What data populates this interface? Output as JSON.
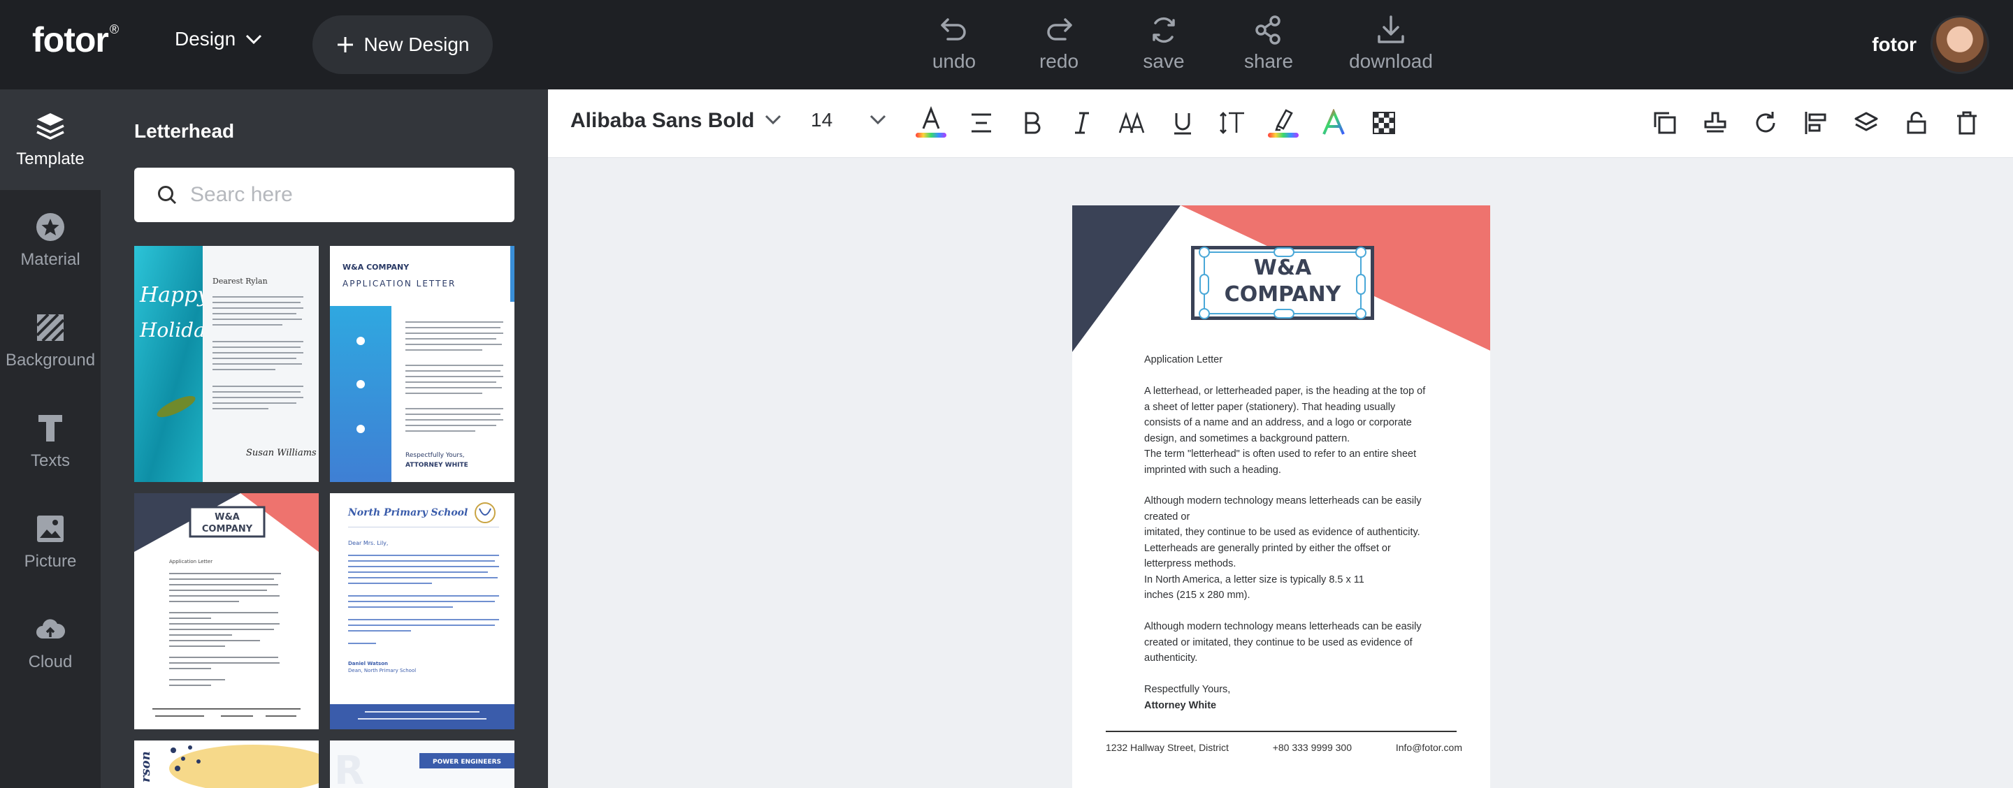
{
  "header": {
    "logo": "fotor",
    "logo_mark": "®",
    "design_menu": "Design",
    "new_design": "New Design",
    "tools": [
      {
        "label": "undo",
        "icon": "undo-icon"
      },
      {
        "label": "redo",
        "icon": "redo-icon"
      },
      {
        "label": "save",
        "icon": "save-icon"
      },
      {
        "label": "share",
        "icon": "share-icon"
      },
      {
        "label": "download",
        "icon": "download-icon"
      }
    ],
    "user_name": "fotor"
  },
  "leftnav": {
    "items": [
      {
        "label": "Template",
        "icon": "layers-icon",
        "active": true
      },
      {
        "label": "Material",
        "icon": "star-icon"
      },
      {
        "label": "Background",
        "icon": "background-icon"
      },
      {
        "label": "Texts",
        "icon": "text-icon"
      },
      {
        "label": "Picture",
        "icon": "picture-icon"
      },
      {
        "label": "Cloud",
        "icon": "cloud-icon"
      }
    ]
  },
  "panel": {
    "title": "Letterhead",
    "search_placeholder": "Searc here",
    "templates": [
      {
        "title": "Happy Holiday",
        "recipient": "Dearest Rylan",
        "signature": "Susan Williams"
      },
      {
        "title": "W&A COMPANY",
        "subtitle": "APPLICATION LETTER",
        "closing": "Respectfully Yours,",
        "signer": "ATTORNEY WHITE"
      },
      {
        "title": "W&A COMPANY",
        "subtitle": "Application Letter"
      },
      {
        "title": "North Primary School",
        "greeting": "Dear Mrs. Lily,",
        "signer": "Daniel Watson",
        "role": "Dean, North Primary School"
      },
      {
        "title": "rson"
      },
      {
        "title": "POWER ENGINEERS"
      }
    ]
  },
  "format_bar": {
    "font_name": "Alibaba Sans Bold",
    "font_size": "14",
    "colors": {
      "text_underline": "rainbow",
      "accent": "#4aa8d8"
    }
  },
  "letter": {
    "company_line1": "W&A",
    "company_line2": "COMPANY",
    "heading": "Application Letter",
    "paragraphs": [
      [
        "A letterhead, or letterheaded paper, is the heading at the top of",
        "a sheet of letter paper (stationery). That heading usually",
        "consists of a name and an address, and a logo or corporate",
        "design, and sometimes a background pattern.",
        "The term \"letterhead\" is often used to refer to an entire sheet",
        "imprinted with such a heading."
      ],
      [
        "Although modern technology means letterheads can be easily",
        "created or",
        "imitated, they continue to be used as evidence of authenticity.",
        "Letterheads are generally printed by either the offset or",
        "letterpress methods.",
        "In North America, a letter size is typically 8.5 x 11",
        "inches (215 x 280 mm)."
      ],
      [
        "Although modern technology means letterheads can be easily",
        "created or imitated, they continue to be used as evidence of",
        "authenticity."
      ]
    ],
    "closing": "Respectfully Yours,",
    "signer": "Attorney White",
    "footer": {
      "address": "1232 Hallway Street, District",
      "phone": "+80 333 9999 300",
      "email": "Info@fotor.com"
    },
    "colors": {
      "navy": "#3a4256",
      "coral": "#ee736e"
    }
  }
}
